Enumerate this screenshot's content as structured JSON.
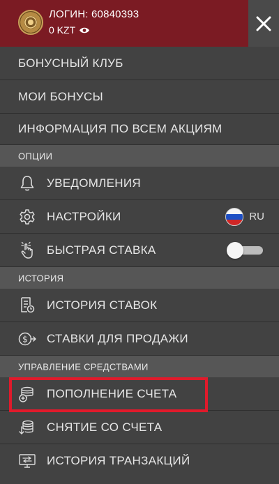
{
  "header": {
    "login_label": "ЛОГИН: 60840393",
    "balance": "0 KZT",
    "eye_icon": "eye-icon",
    "close_icon": "close-icon",
    "accent_color": "#7b1b23"
  },
  "menu": {
    "bonus_club": "БОНУСНЫЙ КЛУБ",
    "my_bonuses": "МОИ БОНУСЫ",
    "promotions_info": "ИНФОРМАЦИЯ ПО ВСЕМ АКЦИЯМ"
  },
  "options": {
    "section_title": "ОПЦИИ",
    "notifications": "УВЕДОМЛЕНИЯ",
    "settings": "НАСТРОЙКИ",
    "language": "RU",
    "quick_bet": "БЫСТРАЯ СТАВКА",
    "quick_bet_enabled": false
  },
  "history": {
    "section_title": "ИСТОРИЯ",
    "bet_history": "ИСТОРИЯ СТАВОК",
    "bets_for_sale": "СТАВКИ ДЛЯ ПРОДАЖИ"
  },
  "funds": {
    "section_title": "УПРАВЛЕНИЕ СРЕДСТВАМИ",
    "deposit": "ПОПОЛНЕНИЕ СЧЕТА",
    "withdrawal": "СНЯТИЕ СО СЧЕТА",
    "transactions": "ИСТОРИЯ ТРАНЗАКЦИЙ",
    "highlight_color": "#e01a2b"
  }
}
